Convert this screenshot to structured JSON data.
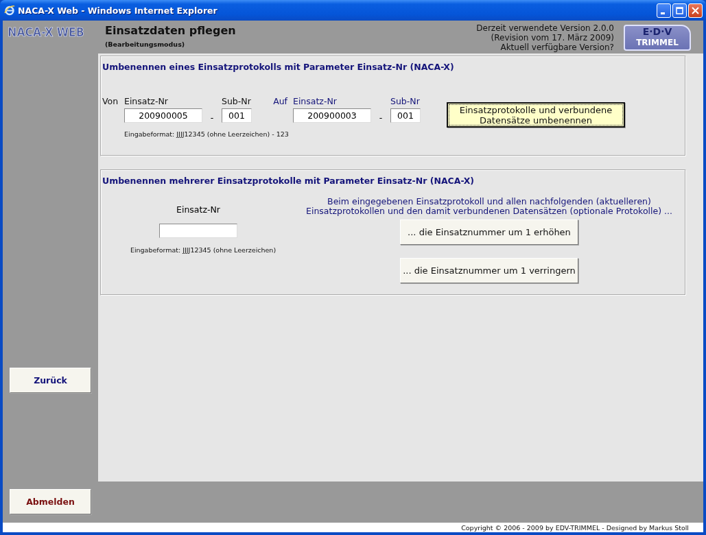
{
  "window": {
    "title": "NACA-X Web - Windows Internet Explorer"
  },
  "header": {
    "logo": "NACA-X WEB",
    "title": "Einsatzdaten pflegen",
    "subtitle": "(Bearbeitungsmodus)",
    "version_lines": [
      "Derzeit verwendete Version 2.0.0",
      "(Revision vom 17. März 2009)",
      "Aktuell verfügbare Version?"
    ],
    "partner_logo": {
      "top": "E·D·V",
      "bottom": "TRIMMEL"
    }
  },
  "sidebar": {
    "buttons": [
      {
        "label": "Zurück",
        "kind": "navigate"
      },
      {
        "label": "Abmelden",
        "kind": "logout"
      }
    ]
  },
  "single_rename": {
    "heading": "Umbenennen eines Einsatzprotokolls mit Parameter Einsatz-Nr (NACA-X)",
    "groups": [
      {
        "kind": "source",
        "label": "Von",
        "number_label": "Einsatz-Nr",
        "number": "200900005",
        "separator": "-",
        "sub_label": "Sub-Nr",
        "sub": "001"
      },
      {
        "kind": "target",
        "label": "Auf",
        "number_label": "Einsatz-Nr",
        "number": "200900003",
        "separator": "-",
        "sub_label": "Sub-Nr",
        "sub": "001"
      }
    ],
    "hint": "Eingabeformat: JJJJ12345 (ohne Leerzeichen) - 123",
    "button": "Einsatzprotokolle und verbundene Datensätze umbenennen"
  },
  "multi_rename": {
    "heading": "Umbenennen mehrerer Einsatzprotokolle mit Parameter Einsatz-Nr (NACA-X)",
    "field_label": "Einsatz-Nr",
    "hint": "Eingabeformat: JJJJ12345 (ohne Leerzeichen)",
    "description_lines": [
      "Beim eingegebenen Einsatzprotokoll und allen nachfolgenden (aktuelleren)",
      "Einsatzprotokollen und den damit verbundenen Datensätzen (optionale Protokolle) ..."
    ],
    "buttons": [
      "... die Einsatznummer um 1 erhöhen",
      "... die Einsatznummer um 1 verringern"
    ]
  },
  "footer": {
    "copyright": "Copyright © 2006 - 2009 by EDV-TRIMMEL - Designed by Markus Stoll"
  }
}
